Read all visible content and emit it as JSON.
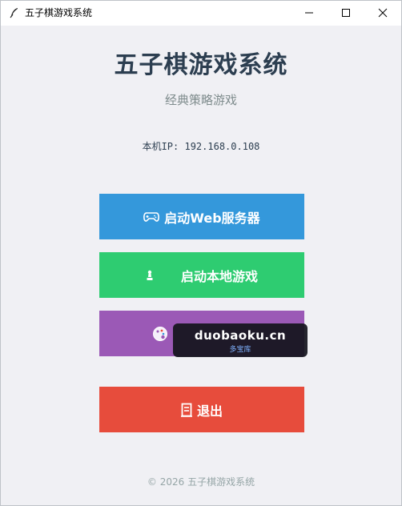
{
  "window": {
    "title": "五子棋游戏系统",
    "icons": {
      "app": "feather-icon",
      "minimize": "minimize-icon",
      "maximize": "maximize-icon",
      "close": "close-icon"
    }
  },
  "header": {
    "title": "五子棋游戏系统",
    "subtitle": "经典策略游戏"
  },
  "network": {
    "ip_label": "本机IP: 192.168.0.108"
  },
  "buttons": [
    {
      "label": "启动Web服务器",
      "icon": "gamepad-icon",
      "color": "#3498db"
    },
    {
      "label": "启动本地游戏",
      "icon": "chess-pawn-icon",
      "color": "#2ecc71"
    },
    {
      "label": "",
      "icon": "palette-icon",
      "color": "#9b59b6"
    },
    {
      "label": "退出",
      "icon": "door-icon",
      "color": "#e74c3c"
    }
  ],
  "footer": {
    "text": "© 2026 五子棋游戏系统"
  },
  "watermark": {
    "main": "duobaoku.cn",
    "sub": "多宝库"
  }
}
